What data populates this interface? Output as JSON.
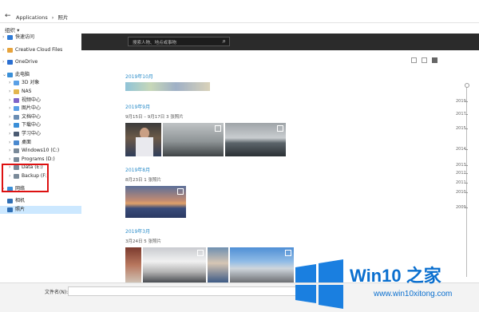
{
  "window": {
    "path": [
      "Applications",
      "›",
      "照片"
    ]
  },
  "toolbar": {
    "organize": "组织 ▾"
  },
  "sidebar": {
    "items": [
      {
        "label": "快速访问",
        "indent": 0,
        "chev": "›",
        "color": "#2f7bd6"
      },
      {
        "gap": true
      },
      {
        "label": "Creative Cloud Files",
        "indent": 0,
        "chev": "›",
        "color": "#e7a33b"
      },
      {
        "gap": true
      },
      {
        "label": "OneDrive",
        "indent": 0,
        "chev": "›",
        "color": "#2b6fd1"
      },
      {
        "gap": true
      },
      {
        "label": "此电脑",
        "indent": 0,
        "chev": "⌄",
        "color": "#3a8fd8"
      },
      {
        "label": "3D 对象",
        "indent": 1,
        "chev": "›",
        "color": "#5aa0e6"
      },
      {
        "label": "NAS",
        "indent": 1,
        "chev": "›",
        "color": "#e3b64e"
      },
      {
        "label": "视频中心",
        "indent": 1,
        "chev": "›",
        "color": "#7f65c9"
      },
      {
        "label": "图片中心",
        "indent": 1,
        "chev": "›",
        "color": "#5aa0e6"
      },
      {
        "label": "文档中心",
        "indent": 1,
        "chev": "›",
        "color": "#6a8db3"
      },
      {
        "label": "下载中心",
        "indent": 1,
        "chev": "›",
        "color": "#3a8fd8"
      },
      {
        "label": "学习中心",
        "indent": 1,
        "chev": "›",
        "color": "#4b5b72"
      },
      {
        "label": "桌面",
        "indent": 1,
        "chev": "›",
        "color": "#4a89cf"
      },
      {
        "label": "Windows10 (C:)",
        "indent": 1,
        "chev": "›",
        "color": "#7a8a99"
      },
      {
        "label": "Programs (D:)",
        "indent": 1,
        "chev": "›",
        "color": "#7a8a99"
      },
      {
        "label": "Data (E:)",
        "indent": 1,
        "chev": "›",
        "color": "#7a8a99"
      },
      {
        "label": "Backup (F:)",
        "indent": 1,
        "chev": "›",
        "color": "#7a8a99"
      },
      {
        "gap": true
      },
      {
        "label": "网络",
        "indent": 0,
        "chev": "›",
        "color": "#3a8fd8"
      },
      {
        "gap": true
      },
      {
        "label": "相机",
        "indent": 0,
        "chev": "",
        "color": "#2f6fb5"
      },
      {
        "label": "照片",
        "indent": 0,
        "chev": "",
        "color": "#2f6fb5",
        "selected": true
      }
    ]
  },
  "search": {
    "placeholder": "搜索人物、地点或事物"
  },
  "groups": [
    {
      "month": "2019年10月"
    },
    {
      "month": "2019年9月",
      "sub": "9月15日 – 9月17日   3 张照片"
    },
    {
      "month": "2019年8月",
      "sub": "8月23日   1 张照片"
    },
    {
      "month": "2019年3月",
      "sub": "3月24日   5 张照片"
    }
  ],
  "timeline": [
    "2019",
    "2017",
    "2015",
    "2014",
    "2013",
    "2012",
    "2011",
    "2010",
    "2009"
  ],
  "bottom": {
    "filename_label": "文件名(N):"
  },
  "logo": {
    "title": "Win10 之家",
    "url": "www.win10xitong.com"
  }
}
